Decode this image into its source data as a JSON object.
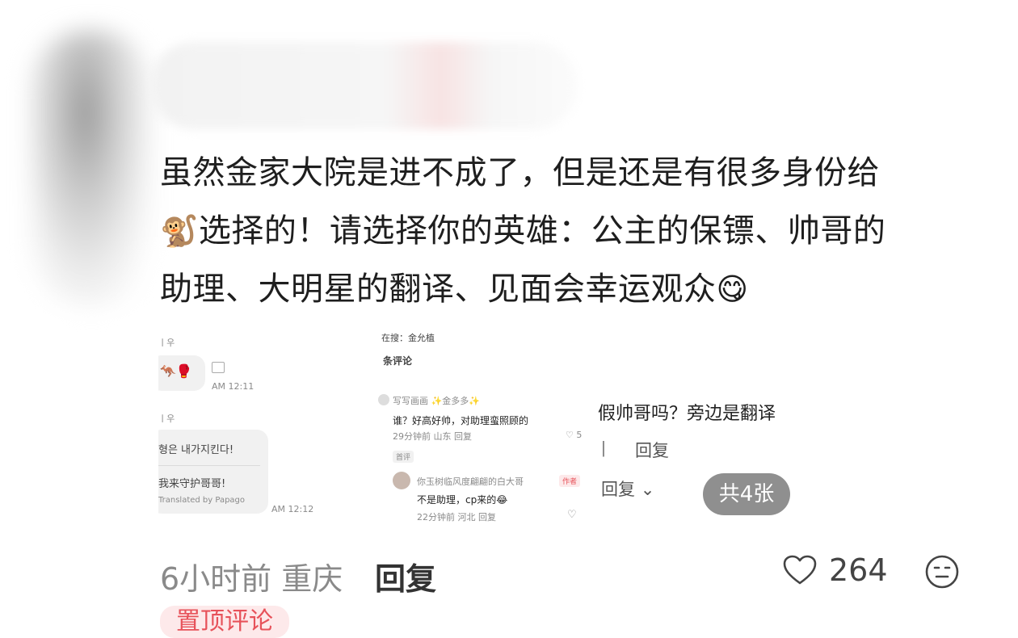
{
  "comment": {
    "line1": "虽然金家大院是进不成了，但是还是有很多身份给",
    "monkey_emoji": "🐒",
    "line2": "选择的！请选择你的英雄：公主的保镖、帅哥的",
    "line3": "助理、大明星的翻译、见面会幸运观众",
    "yum_emoji": "😋"
  },
  "image1": {
    "name1": "ㅣ우",
    "emojis": "🦘🥊",
    "time1": "AM 12:11",
    "name2": "ㅣ우",
    "msg1": "형은 내가지킨다!",
    "msg2": "我来守护哥哥!",
    "translated": "Translated by Papago",
    "time2": "AM 12:12"
  },
  "image2": {
    "search": "在搜：金允植",
    "count": "条评论",
    "user1": "写写画画 ✨金多多✨",
    "text1": "谁？好高好帅，对助理蛮照顾的",
    "meta1": "29分钟前 山东  回复",
    "likes1": "5",
    "first_tag": "首评",
    "user2": "你玉树临风度翩翩的白大哥",
    "author_tag": "作者",
    "text2": "不是助理，cp来的😂",
    "meta2": "22分钟前 河北  回复"
  },
  "image3": {
    "line1": "假帅哥吗？旁边是翻译",
    "line2": "回复",
    "line3": "回复"
  },
  "badge": "共4张",
  "footer": {
    "meta": "6小时前 重庆",
    "reply": "回复",
    "likes": "264",
    "pinned": "置顶评论"
  }
}
